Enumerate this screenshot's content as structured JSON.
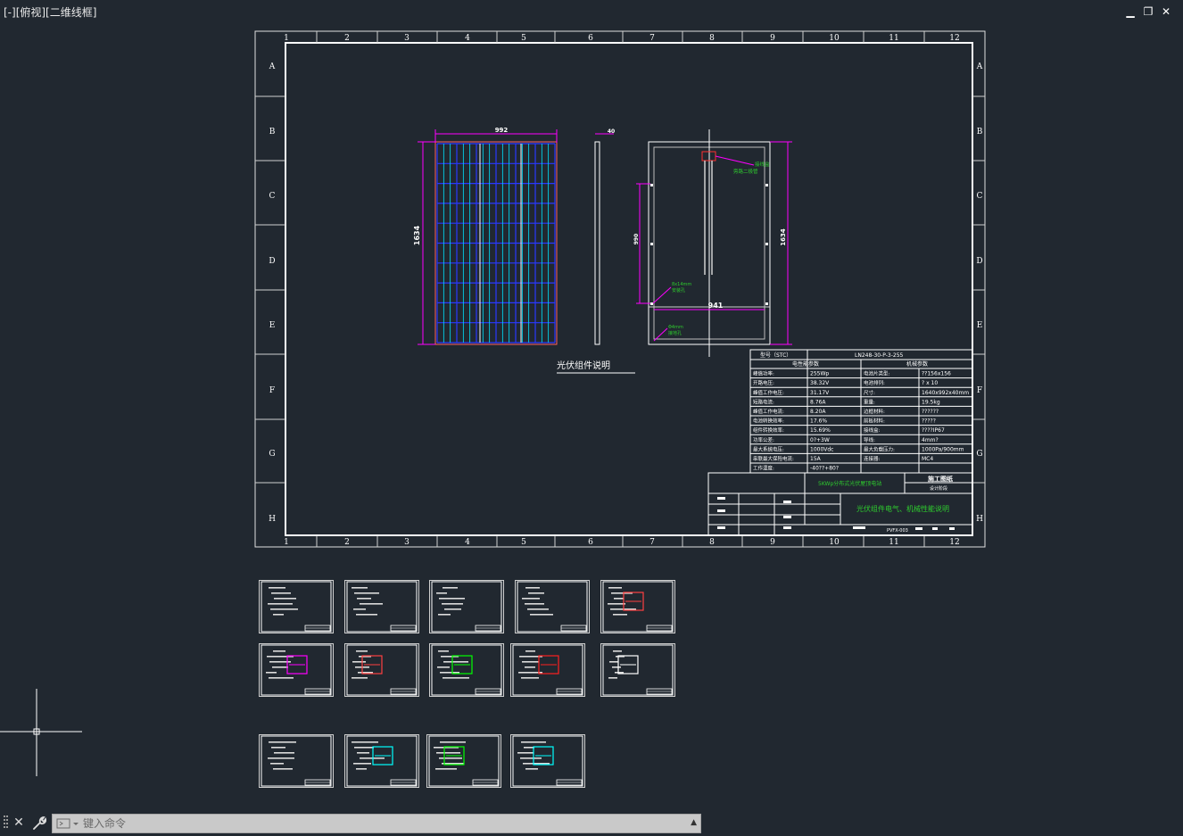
{
  "viewport": {
    "label": "[-][俯视][二维线框]"
  },
  "window_controls": {
    "minimize": "▁",
    "restore": "❐",
    "close": "✕"
  },
  "sheet": {
    "col_labels": [
      "1",
      "2",
      "3",
      "4",
      "5",
      "6",
      "7",
      "8",
      "9",
      "10",
      "11",
      "12"
    ],
    "row_labels": [
      "A",
      "B",
      "C",
      "D",
      "E",
      "F",
      "G",
      "H"
    ],
    "front_view": {
      "width_dim": "992",
      "height_dim": "1634"
    },
    "side_view": {
      "thickness_dim": "40"
    },
    "back_view": {
      "height_dim": "1634",
      "width_dim": "941",
      "mount_dim": "990",
      "note_junction": "接线盒\n旁路二极管",
      "note_holes": "8x14mm\n安装孔",
      "note_ground": "Φ4mm\n接地孔"
    },
    "drawing_caption": "光伏组件说明",
    "spec_table": {
      "model_label": "型号（STC）",
      "model_value": "LN248-30-P-3-255",
      "electrical_header": "电性能参数",
      "mechanical_header": "机械参数",
      "rows": [
        {
          "k1": "峰值功率:",
          "v1": "255Wp",
          "k2": "电池片类型:",
          "v2": "??156x156"
        },
        {
          "k1": "开路电压:",
          "v1": "38.32V",
          "k2": "电池排列:",
          "v2": "? x 10"
        },
        {
          "k1": "峰值工作电压:",
          "v1": "31.17V",
          "k2": "尺寸:",
          "v2": "1640x992x40mm"
        },
        {
          "k1": "短路电流:",
          "v1": "8.76A",
          "k2": "重量:",
          "v2": "19.5kg"
        },
        {
          "k1": "峰值工作电流:",
          "v1": "8.20A",
          "k2": "边框材料:",
          "v2": "??????"
        },
        {
          "k1": "电池转换效率:",
          "v1": "17.6%",
          "k2": "前板材料:",
          "v2": "?????"
        },
        {
          "k1": "组件转换效率:",
          "v1": "15.69%",
          "k2": "接线盒:",
          "v2": "????IP67"
        },
        {
          "k1": "功率公差:",
          "v1": "0?+3W",
          "k2": "导线:",
          "v2": "4mm?"
        },
        {
          "k1": "最大系统电压:",
          "v1": "1000Vdc",
          "k2": "最大负载压力:",
          "v2": "1000Pa/900mm"
        },
        {
          "k1": "串联最大保险电流:",
          "v1": "15A",
          "k2": "连接器:",
          "v2": "MC4"
        },
        {
          "k1": "工作温度:",
          "v1": "-40??+80?",
          "k2": "",
          "v2": ""
        }
      ]
    },
    "title_block": {
      "project": "5KWp分布式光伏屋顶电站",
      "stage": "施工图纸",
      "stage_sub": "设计阶段",
      "drawing_title": "光伏组件电气、机械性能说明",
      "drawing_no": "PVFX-003"
    }
  },
  "command_line": {
    "close": "✕",
    "placeholder": "键入命令",
    "history": "▲"
  },
  "colors": {
    "background": "#212830",
    "frame": "#ffffff",
    "dimension": "#ff00ff",
    "green_text": "#00ff00",
    "cell_blue": "#2a38ff",
    "cell_cyan": "#00ffff"
  }
}
